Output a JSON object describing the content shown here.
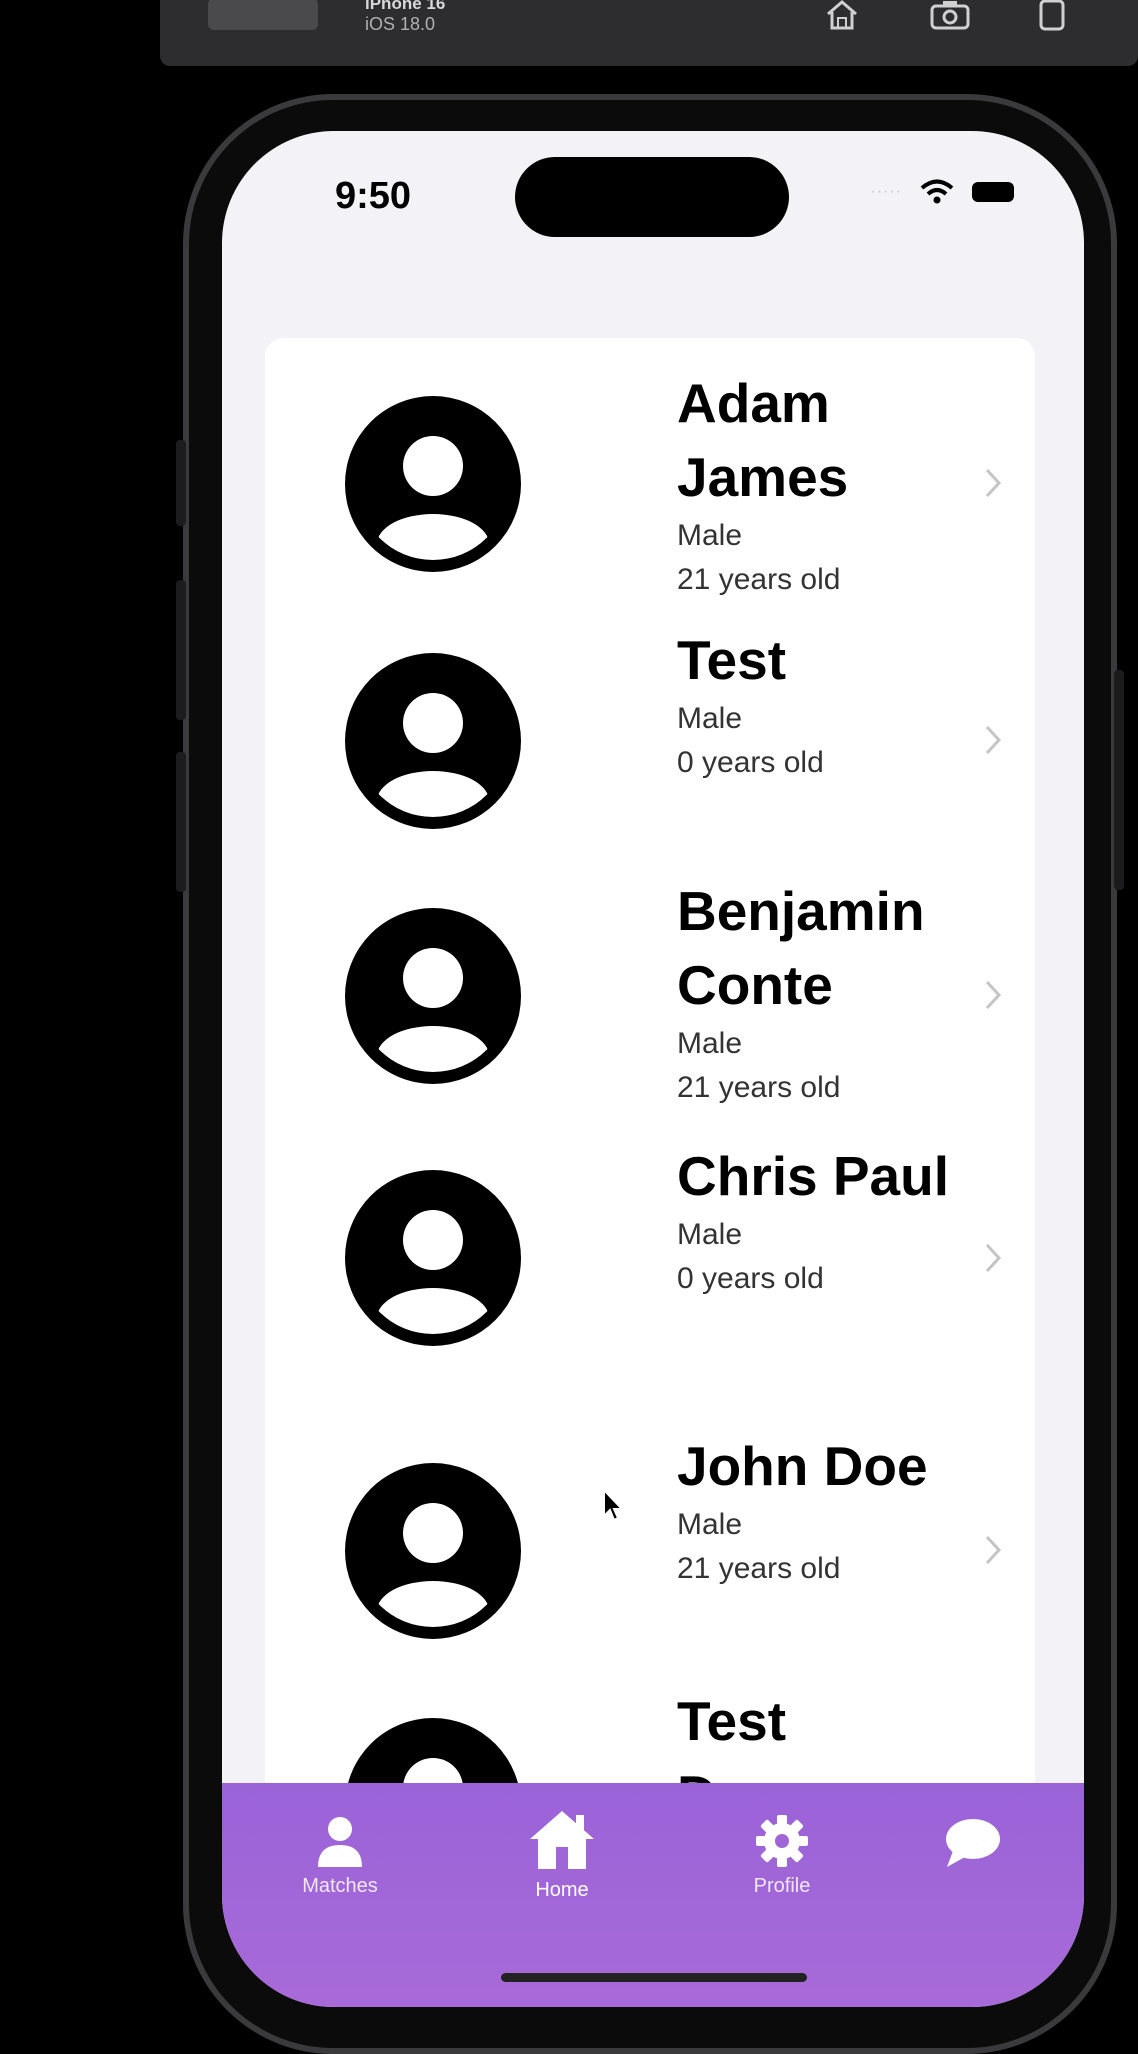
{
  "simulator": {
    "device_name": "iPhone 16",
    "os_version": "iOS 18.0",
    "buttons": [
      "home-icon",
      "screenshot-icon",
      "rotate-icon"
    ]
  },
  "status_bar": {
    "time": "9:50",
    "signal": "·····"
  },
  "matches": [
    {
      "name": "Adam James",
      "gender": "Male",
      "age": "21 years old"
    },
    {
      "name": "Test",
      "gender": "Male",
      "age": "0 years old"
    },
    {
      "name": "Benjamin Conte",
      "gender": "Male",
      "age": "21 years old"
    },
    {
      "name": "Chris Paul",
      "gender": "Male",
      "age": "0 years old"
    },
    {
      "name": "John Doe",
      "gender": "Male",
      "age": "21 years old"
    },
    {
      "name": "Test Dummy",
      "gender": "",
      "age": ""
    }
  ],
  "tab_bar": {
    "tabs": [
      {
        "label": "Matches",
        "icon": "person-icon"
      },
      {
        "label": "Home",
        "icon": "home-icon"
      },
      {
        "label": "Profile",
        "icon": "gear-icon"
      },
      {
        "label": "",
        "icon": "chat-bubble-icon"
      }
    ],
    "colors": {
      "start": "#9a63d8",
      "end": "#a86ad8"
    }
  }
}
